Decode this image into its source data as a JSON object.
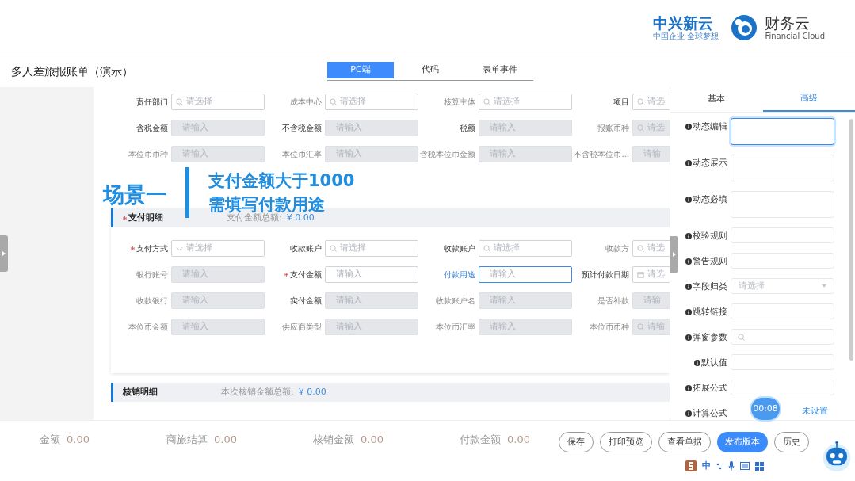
{
  "header": {
    "brand": "中兴新云",
    "slogan": "中国企业 全球梦想",
    "product": "财务云",
    "product_en": "Financial Cloud"
  },
  "title": "多人差旅报账单（演示）",
  "tabs": [
    {
      "label": "PC端",
      "selected": true
    },
    {
      "label": "代码",
      "selected": false
    },
    {
      "label": "表单事件",
      "selected": false
    }
  ],
  "form": {
    "rows": [
      [
        {
          "label": "责任部门",
          "kind": "search",
          "placeholder": "请选择",
          "disabled": false,
          "muted": false,
          "focused": false,
          "required": false
        },
        {
          "label": "成本中心",
          "kind": "search",
          "placeholder": "请选择",
          "disabled": false,
          "muted": true,
          "focused": false,
          "required": false
        },
        {
          "label": "核算主体",
          "kind": "search",
          "placeholder": "请选择",
          "disabled": false,
          "muted": true,
          "focused": false,
          "required": false
        },
        {
          "label": "项目",
          "kind": "search",
          "placeholder": "请选",
          "disabled": false,
          "muted": false,
          "focused": false,
          "required": false
        }
      ],
      [
        {
          "label": "含税金额",
          "kind": "text",
          "placeholder": "请输入",
          "disabled": true,
          "muted": false,
          "focused": false,
          "required": false
        },
        {
          "label": "不含税金额",
          "kind": "text",
          "placeholder": "请输入",
          "disabled": true,
          "muted": false,
          "focused": false,
          "required": false
        },
        {
          "label": "税额",
          "kind": "text",
          "placeholder": "请输入",
          "disabled": true,
          "muted": false,
          "focused": false,
          "required": false
        },
        {
          "label": "报账币种",
          "kind": "search",
          "placeholder": "请选",
          "disabled": true,
          "muted": true,
          "focused": false,
          "required": false
        }
      ],
      [
        {
          "label": "本位币币种",
          "kind": "text",
          "placeholder": "请输入",
          "disabled": true,
          "muted": true,
          "focused": false,
          "required": false
        },
        {
          "label": "本位币汇率",
          "kind": "text",
          "placeholder": "请输入",
          "disabled": true,
          "muted": true,
          "focused": false,
          "required": false
        },
        {
          "label": "含税本位币金额",
          "kind": "text",
          "placeholder": "请输入",
          "disabled": true,
          "muted": true,
          "focused": false,
          "required": false
        },
        {
          "label": "不含税本位币...",
          "kind": "text",
          "placeholder": "请输",
          "disabled": true,
          "muted": true,
          "focused": false,
          "required": false
        }
      ]
    ]
  },
  "callout": {
    "scene": "场景一",
    "lines": [
      "支付金额大于1000",
      "需填写付款用途"
    ]
  },
  "sections": [
    {
      "title": "支付明细",
      "required": true,
      "summary_label": "支付金额总额:",
      "summary_value": "¥ 0.00",
      "rows": [
        [
          {
            "label": "支付方式",
            "kind": "select",
            "placeholder": "请选择",
            "disabled": false,
            "muted": false,
            "focused": false,
            "required": true
          },
          {
            "label": "收款账户",
            "kind": "search",
            "placeholder": "请选择",
            "disabled": false,
            "muted": false,
            "focused": false,
            "required": false
          },
          {
            "label": "收款账户",
            "kind": "search",
            "placeholder": "请选择",
            "disabled": false,
            "muted": false,
            "focused": false,
            "required": false
          },
          {
            "label": "收款方",
            "kind": "search",
            "placeholder": "请选",
            "disabled": false,
            "muted": true,
            "focused": false,
            "required": false
          }
        ],
        [
          {
            "label": "银行账号",
            "kind": "text",
            "placeholder": "请输入",
            "disabled": true,
            "muted": true,
            "focused": false,
            "required": false
          },
          {
            "label": "支付金额",
            "kind": "text",
            "placeholder": "请输入",
            "disabled": false,
            "muted": false,
            "focused": false,
            "required": true
          },
          {
            "label": "付款用途",
            "kind": "text",
            "placeholder": "请输入",
            "disabled": false,
            "muted": false,
            "focused": true,
            "required": false
          },
          {
            "label": "预计付款日期",
            "kind": "date",
            "placeholder": "请选",
            "disabled": false,
            "muted": false,
            "focused": false,
            "required": false
          }
        ],
        [
          {
            "label": "收款银行",
            "kind": "text",
            "placeholder": "请输入",
            "disabled": true,
            "muted": true,
            "focused": false,
            "required": false
          },
          {
            "label": "实付金额",
            "kind": "text",
            "placeholder": "请输入",
            "disabled": true,
            "muted": false,
            "focused": false,
            "required": false
          },
          {
            "label": "收款账户名",
            "kind": "text",
            "placeholder": "请输入",
            "disabled": true,
            "muted": true,
            "focused": false,
            "required": false
          },
          {
            "label": "是否补款",
            "kind": "text",
            "placeholder": "请输",
            "disabled": true,
            "muted": true,
            "focused": false,
            "required": false
          }
        ],
        [
          {
            "label": "本位币金额",
            "kind": "text",
            "placeholder": "请输入",
            "disabled": true,
            "muted": true,
            "focused": false,
            "required": false
          },
          {
            "label": "供应商类型",
            "kind": "text",
            "placeholder": "请输入",
            "disabled": true,
            "muted": true,
            "focused": false,
            "required": false
          },
          {
            "label": "本位币汇率",
            "kind": "text",
            "placeholder": "请输入",
            "disabled": true,
            "muted": true,
            "focused": false,
            "required": false
          },
          {
            "label": "本位币币种",
            "kind": "search",
            "placeholder": "请输",
            "disabled": true,
            "muted": true,
            "focused": false,
            "required": false
          }
        ]
      ]
    },
    {
      "title": "核销明细",
      "required": false,
      "summary_label": "本次核销金额总额:",
      "summary_value": "¥ 0.00"
    }
  ],
  "panel": {
    "tabs": [
      {
        "label": "基本",
        "selected": false
      },
      {
        "label": "高级",
        "selected": true
      }
    ],
    "fields": [
      {
        "label": "动态编辑",
        "kind": "textarea",
        "focused": true
      },
      {
        "label": "动态展示",
        "kind": "textarea",
        "focused": false
      },
      {
        "label": "动态必填",
        "kind": "textarea",
        "focused": false
      },
      {
        "label": "校验规则",
        "kind": "input",
        "focused": false
      },
      {
        "label": "警告规则",
        "kind": "input",
        "focused": false
      },
      {
        "label": "字段归类",
        "kind": "select",
        "focused": false,
        "placeholder": "请选择"
      },
      {
        "label": "跳转链接",
        "kind": "input",
        "focused": false
      },
      {
        "label": "弹窗参数",
        "kind": "search",
        "focused": false
      },
      {
        "label": "默认值",
        "kind": "input",
        "focused": false
      },
      {
        "label": "拓展公式",
        "kind": "input",
        "focused": false
      },
      {
        "label": "计算公式",
        "kind": "link",
        "value": "未设置"
      }
    ]
  },
  "footer": {
    "totals": [
      {
        "label": "金额",
        "value": "0.00"
      },
      {
        "label": "商旅结算",
        "value": "0.00"
      },
      {
        "label": "核销金额",
        "value": "0.00"
      },
      {
        "label": "付款金额",
        "value": "0.00"
      }
    ],
    "buttons": [
      {
        "label": "保存",
        "kind": "outline"
      },
      {
        "label": "打印预览",
        "kind": "outline"
      },
      {
        "label": "查看单据",
        "kind": "outline"
      },
      {
        "label": "发布版本",
        "kind": "primary"
      },
      {
        "label": "历史",
        "kind": "outline"
      }
    ]
  },
  "timer": "00:08",
  "ime": {
    "label": "中"
  }
}
